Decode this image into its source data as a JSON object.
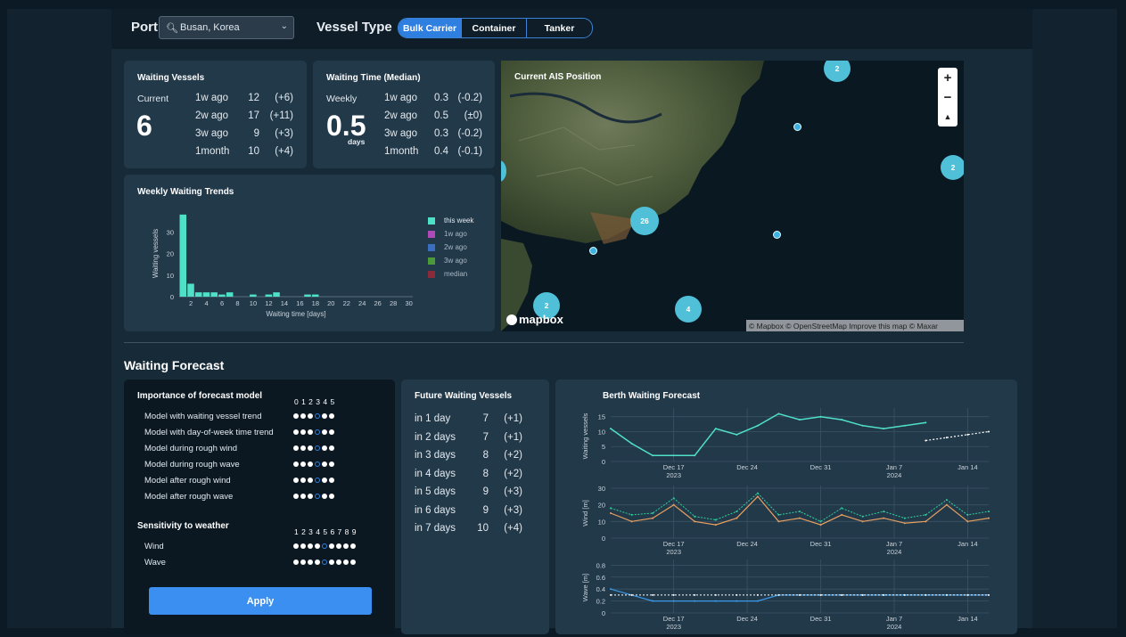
{
  "header": {
    "port_label": "Port",
    "port_value": "Busan, Korea",
    "vessel_type_label": "Vessel Type",
    "vessel_types": [
      "Bulk Carrier",
      "Container",
      "Tanker"
    ],
    "vessel_type_selected": "Bulk Carrier"
  },
  "waiting_vessels": {
    "title": "Waiting Vessels",
    "current_label": "Current",
    "current_value": "6",
    "rows": [
      {
        "label": "1w ago",
        "value": "12",
        "delta": "(+6)"
      },
      {
        "label": "2w ago",
        "value": "17",
        "delta": "(+11)"
      },
      {
        "label": "3w ago",
        "value": "9",
        "delta": "(+3)"
      },
      {
        "label": "1month",
        "value": "10",
        "delta": "(+4)"
      }
    ]
  },
  "waiting_time": {
    "title": "Waiting Time (Median)",
    "weekly_label": "Weekly",
    "weekly_value": "0.5",
    "unit": "days",
    "rows": [
      {
        "label": "1w ago",
        "value": "0.3",
        "delta": "(-0.2)"
      },
      {
        "label": "2w ago",
        "value": "0.5",
        "delta": "(±0)"
      },
      {
        "label": "3w ago",
        "value": "0.3",
        "delta": "(-0.2)"
      },
      {
        "label": "1month",
        "value": "0.4",
        "delta": "(-0.1)"
      }
    ]
  },
  "trends": {
    "title": "Weekly Waiting Trends",
    "legend": [
      {
        "label": "this week",
        "color": "#4fe0c8"
      },
      {
        "label": "1w ago",
        "color": "#b04ab8"
      },
      {
        "label": "2w ago",
        "color": "#3a6fc0"
      },
      {
        "label": "3w ago",
        "color": "#4a9a3a"
      },
      {
        "label": "median",
        "color": "#8a2a3a"
      }
    ]
  },
  "map": {
    "title": "Current AIS Position",
    "clusters": [
      "2",
      "2",
      "26",
      "2",
      "4"
    ],
    "zoom_in": "+",
    "zoom_out": "−",
    "compass": "▲",
    "logo": "mapbox",
    "attribution": "© Mapbox © OpenStreetMap Improve this map © Maxar"
  },
  "forecast": {
    "section_title": "Waiting Forecast",
    "importance_title": "Importance of forecast model",
    "importance_scale": "0 1 2 3 4 5",
    "models": [
      {
        "label": "Model with waiting vessel trend",
        "level": 3
      },
      {
        "label": "Model with day-of-week time trend",
        "level": 3
      },
      {
        "label": "Model during rough wind",
        "level": 3
      },
      {
        "label": "Model during rough wave",
        "level": 3
      },
      {
        "label": "Model after rough wind",
        "level": 3
      },
      {
        "label": "Model after rough wave",
        "level": 3
      }
    ],
    "sensitivity_title": "Sensitivity to weather",
    "sensitivity_scale": "1 2 3 4 5 6 7 8 9",
    "sensitivity": [
      {
        "label": "Wind",
        "level": 5
      },
      {
        "label": "Wave",
        "level": 5
      }
    ],
    "apply_label": "Apply"
  },
  "future": {
    "title": "Future Waiting Vessels",
    "rows": [
      {
        "label": "in 1 day",
        "value": "7",
        "delta": "(+1)"
      },
      {
        "label": "in 2 days",
        "value": "7",
        "delta": "(+1)"
      },
      {
        "label": "in 3 days",
        "value": "8",
        "delta": "(+2)"
      },
      {
        "label": "in 4 days",
        "value": "8",
        "delta": "(+2)"
      },
      {
        "label": "in 5 days",
        "value": "9",
        "delta": "(+3)"
      },
      {
        "label": "in 6 days",
        "value": "9",
        "delta": "(+3)"
      },
      {
        "label": "in 7 days",
        "value": "10",
        "delta": "(+4)"
      }
    ]
  },
  "berth": {
    "title": "Berth Waiting Forecast",
    "x_ticks": [
      "Dec 17",
      "Dec 24",
      "Dec 31",
      "Jan 7",
      "Jan 14"
    ],
    "x_years": [
      "2023",
      "",
      "",
      "2024",
      ""
    ]
  },
  "chart_data": [
    {
      "type": "bar",
      "title": "Weekly Waiting Trends",
      "xlabel": "Waiting time [days]",
      "ylabel": "Waiting vessels",
      "x": [
        1,
        2,
        3,
        4,
        5,
        6,
        7,
        8,
        9,
        10,
        11,
        12,
        13,
        14,
        15,
        16,
        17,
        18,
        19,
        20,
        21,
        22,
        23,
        24,
        25,
        26,
        27,
        28,
        29,
        30
      ],
      "x_ticks": [
        "2",
        "4",
        "6",
        "8",
        "10",
        "12",
        "14",
        "16",
        "18",
        "20",
        "22",
        "24",
        "26",
        "28",
        "30"
      ],
      "y_ticks": [
        "0",
        "10",
        "20",
        "30"
      ],
      "ylim": [
        0,
        40
      ],
      "series": [
        {
          "name": "this week",
          "values": [
            38,
            6,
            2,
            2,
            2,
            1,
            2,
            0,
            0,
            1,
            0,
            1,
            2,
            0,
            0,
            0,
            1,
            1,
            0,
            0,
            0,
            0,
            0,
            0,
            0,
            0,
            0,
            0,
            0,
            0
          ]
        }
      ]
    },
    {
      "type": "line",
      "title": "Berth Waiting Forecast",
      "ylabel": "Waiting vessels",
      "x": [
        "2023-12-11",
        "2023-12-13",
        "2023-12-15",
        "2023-12-17",
        "2023-12-19",
        "2023-12-21",
        "2023-12-23",
        "2023-12-25",
        "2023-12-27",
        "2023-12-29",
        "2023-12-31",
        "2024-01-02",
        "2024-01-04",
        "2024-01-06",
        "2024-01-08",
        "2024-01-10",
        "2024-01-12",
        "2024-01-14",
        "2024-01-16"
      ],
      "y_ticks": [
        "0",
        "5",
        "10",
        "15"
      ],
      "ylim": [
        0,
        17
      ],
      "series": [
        {
          "values": [
            11,
            6,
            2,
            2,
            2,
            11,
            9,
            12,
            16,
            14,
            15,
            14,
            12,
            11,
            12,
            13,
            null,
            null,
            null
          ]
        },
        {
          "values": [
            null,
            null,
            null,
            null,
            null,
            null,
            null,
            null,
            null,
            null,
            null,
            null,
            null,
            null,
            null,
            7,
            8,
            9,
            10
          ]
        }
      ]
    },
    {
      "type": "line",
      "ylabel": "Wind [m]",
      "x": [
        "2023-12-11",
        "2023-12-13",
        "2023-12-15",
        "2023-12-17",
        "2023-12-19",
        "2023-12-21",
        "2023-12-23",
        "2023-12-25",
        "2023-12-27",
        "2023-12-29",
        "2023-12-31",
        "2024-01-02",
        "2024-01-04",
        "2024-01-06",
        "2024-01-08",
        "2024-01-10",
        "2024-01-12",
        "2024-01-14",
        "2024-01-16"
      ],
      "y_ticks": [
        "0",
        "10",
        "20",
        "30"
      ],
      "ylim": [
        0,
        30
      ],
      "series": [
        {
          "values": [
            15,
            10,
            12,
            20,
            10,
            8,
            12,
            25,
            10,
            12,
            8,
            14,
            10,
            12,
            9,
            10,
            20,
            10,
            12
          ]
        },
        {
          "values": [
            18,
            14,
            15,
            24,
            13,
            11,
            16,
            27,
            14,
            16,
            10,
            18,
            13,
            16,
            12,
            14,
            23,
            14,
            16
          ]
        }
      ]
    },
    {
      "type": "line",
      "ylabel": "Wave [m]",
      "x": [
        "2023-12-11",
        "2023-12-13",
        "2023-12-15",
        "2023-12-17",
        "2023-12-19",
        "2023-12-21",
        "2023-12-23",
        "2023-12-25",
        "2023-12-27",
        "2023-12-29",
        "2023-12-31",
        "2024-01-02",
        "2024-01-04",
        "2024-01-06",
        "2024-01-08",
        "2024-01-10",
        "2024-01-12",
        "2024-01-14",
        "2024-01-16"
      ],
      "y_ticks": [
        "0",
        "0.2",
        "0.4",
        "0.6",
        "0.8"
      ],
      "ylim": [
        0,
        0.85
      ],
      "series": [
        {
          "values": [
            0.4,
            0.3,
            0.2,
            0.2,
            0.2,
            0.2,
            0.2,
            0.2,
            0.3,
            0.3,
            0.3,
            0.3,
            0.3,
            0.3,
            0.3,
            0.3,
            0.3,
            0.3,
            0.3
          ]
        },
        {
          "values": [
            0.3,
            0.3,
            0.3,
            0.3,
            0.3,
            0.3,
            0.3,
            0.3,
            0.3,
            0.3,
            0.3,
            0.3,
            0.3,
            0.3,
            0.3,
            0.3,
            0.3,
            0.3,
            0.3
          ]
        }
      ]
    }
  ]
}
